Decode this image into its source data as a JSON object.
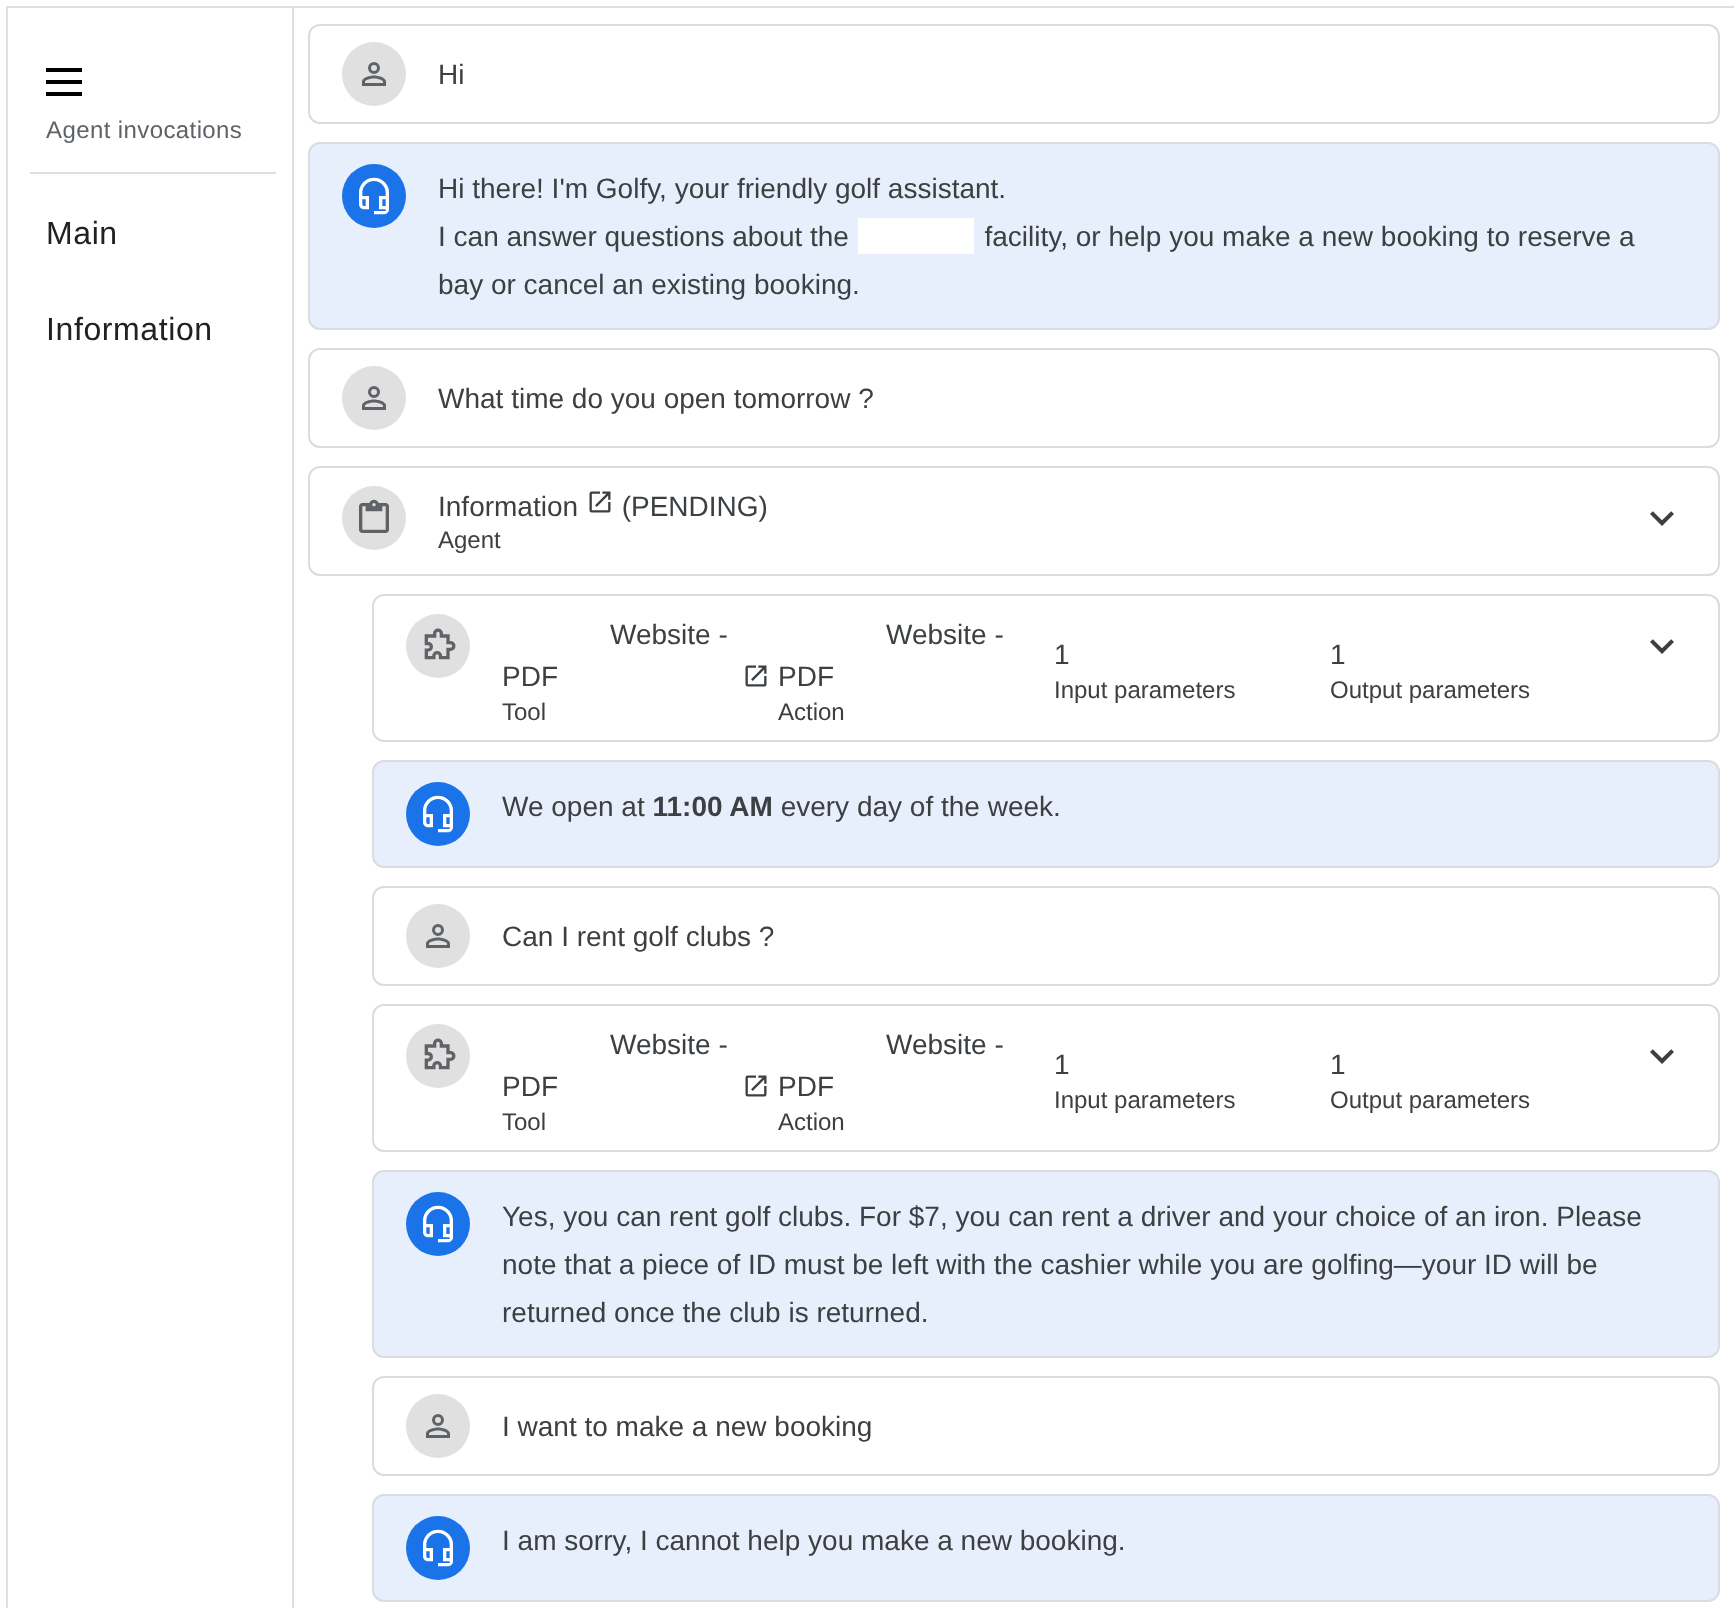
{
  "sidebar": {
    "title": "Agent invocations",
    "items": [
      {
        "label": "Main"
      },
      {
        "label": "Information"
      }
    ]
  },
  "messages": [
    {
      "kind": "user",
      "text": "Hi"
    },
    {
      "kind": "assistant",
      "paragraphs": [
        [
          {
            "kind": "text",
            "text": "Hi there! I'm Golfy, your friendly golf assistant."
          }
        ],
        [
          {
            "kind": "text",
            "text": "I can answer questions about the"
          },
          {
            "kind": "redacted"
          },
          {
            "kind": "text",
            "text": "facility, or help you make a new booking to reserve a"
          }
        ],
        [
          {
            "kind": "text",
            "text": "bay or cancel an existing booking."
          }
        ]
      ]
    },
    {
      "kind": "user",
      "text": "What time do you open tomorrow ?"
    },
    {
      "kind": "agent",
      "name": "Information",
      "status": "(PENDING)",
      "role": "Agent",
      "children": [
        {
          "kind": "tool",
          "name": "Website - PDF",
          "name_label": "Tool",
          "action": "Website - PDF",
          "action_label": "Action",
          "inputs": "1",
          "inputs_label": "Input parameters",
          "outputs": "1",
          "outputs_label": "Output parameters"
        },
        {
          "kind": "assistant",
          "paragraphs": [
            [
              {
                "kind": "text",
                "text": "We open at **11:00 AM** every day of the week."
              }
            ]
          ]
        },
        {
          "kind": "user",
          "text": "Can I rent golf clubs ?"
        },
        {
          "kind": "tool",
          "name": "Website - PDF",
          "name_label": "Tool",
          "action": "Website - PDF",
          "action_label": "Action",
          "inputs": "1",
          "inputs_label": "Input parameters",
          "outputs": "1",
          "outputs_label": "Output parameters"
        },
        {
          "kind": "assistant",
          "paragraphs": [
            [
              {
                "kind": "text",
                "text": "Yes, you can rent golf clubs. For $7, you can rent a driver and your choice of an iron. Please note that a piece of ID must be left with the cashier while you are golfing—your ID will be returned once the club is returned."
              }
            ]
          ]
        },
        {
          "kind": "user",
          "text": "I want to make a new booking"
        },
        {
          "kind": "assistant",
          "paragraphs": [
            [
              {
                "kind": "text",
                "text": "I am sorry, I cannot help you make a new booking."
              }
            ]
          ]
        }
      ]
    }
  ]
}
